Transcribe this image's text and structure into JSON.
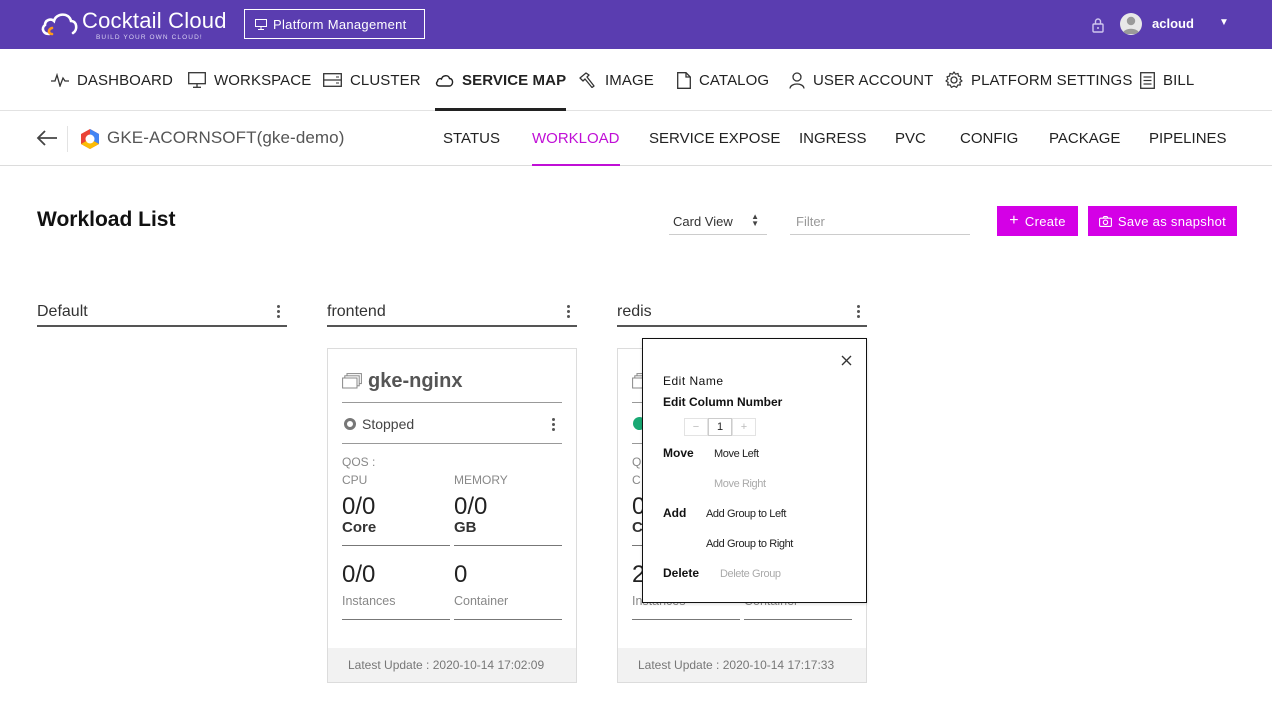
{
  "header": {
    "logo_title": "Cocktail Cloud",
    "logo_subtitle": "BUILD YOUR OWN CLOUD!",
    "platform_button": "Platform Management",
    "username": "acloud",
    "caret": "▼"
  },
  "nav": {
    "items": [
      {
        "label": "DASHBOARD",
        "icon": "pulse-icon"
      },
      {
        "label": "WORKSPACE",
        "icon": "monitor-icon"
      },
      {
        "label": "CLUSTER",
        "icon": "server-icon"
      },
      {
        "label": "SERVICE MAP",
        "icon": "cloud-icon",
        "active": true
      },
      {
        "label": "IMAGE",
        "icon": "hammer-icon"
      },
      {
        "label": "CATALOG",
        "icon": "file-icon"
      },
      {
        "label": "USER ACCOUNT",
        "icon": "user-icon"
      },
      {
        "label": "PLATFORM SETTINGS",
        "icon": "gear-icon"
      },
      {
        "label": "BILL",
        "icon": "bill-icon"
      }
    ]
  },
  "subnav": {
    "cluster": "GKE-ACORNSOFT(gke-demo)",
    "tabs": [
      "STATUS",
      "WORKLOAD",
      "SERVICE EXPOSE",
      "INGRESS",
      "PVC",
      "CONFIG",
      "PACKAGE",
      "PIPELINES"
    ],
    "active_tab": "WORKLOAD"
  },
  "toolbar": {
    "title": "Workload List",
    "view_select": "Card View",
    "filter_placeholder": "Filter",
    "create_label": "Create",
    "snapshot_label": "Save as snapshot"
  },
  "groups": [
    "Default",
    "frontend",
    "redis"
  ],
  "cards": [
    {
      "name": "gke-nginx",
      "status": "Stopped",
      "qos": "QOS :",
      "cpu_label": "CPU",
      "cpu_value": "0/0",
      "cpu_unit": "Core",
      "memory_label": "MEMORY",
      "memory_value": "0/0",
      "memory_unit": "GB",
      "instances_value": "0/0",
      "instances_label": "Instances",
      "container_value": "0",
      "container_label": "Container",
      "updated": "Latest Update : 2020-10-14 17:02:09"
    },
    {
      "name_fragment": "",
      "qos_fragment": "Q",
      "cpu_fragment": "C",
      "value_fragment": "0",
      "unit_fragment": "C",
      "instances_fragment": "2",
      "instances_label": "Instances",
      "container_label": "Container",
      "updated": "Latest Update : 2020-10-14 17:17:33"
    }
  ],
  "popup": {
    "edit_name": "Edit Name",
    "edit_column": "Edit Column Number",
    "column_value": "1",
    "minus": "−",
    "plus": "+",
    "move_label": "Move",
    "move_left": "Move Left",
    "move_right": "Move Right",
    "add_label": "Add",
    "add_left": "Add Group to Left",
    "add_right": "Add Group to Right",
    "delete_label": "Delete",
    "delete_group": "Delete Group"
  },
  "colors": {
    "header_bg": "#5a3db0",
    "accent": "#c00fd6",
    "button_bg": "#d400e6",
    "running": "#19a974"
  }
}
